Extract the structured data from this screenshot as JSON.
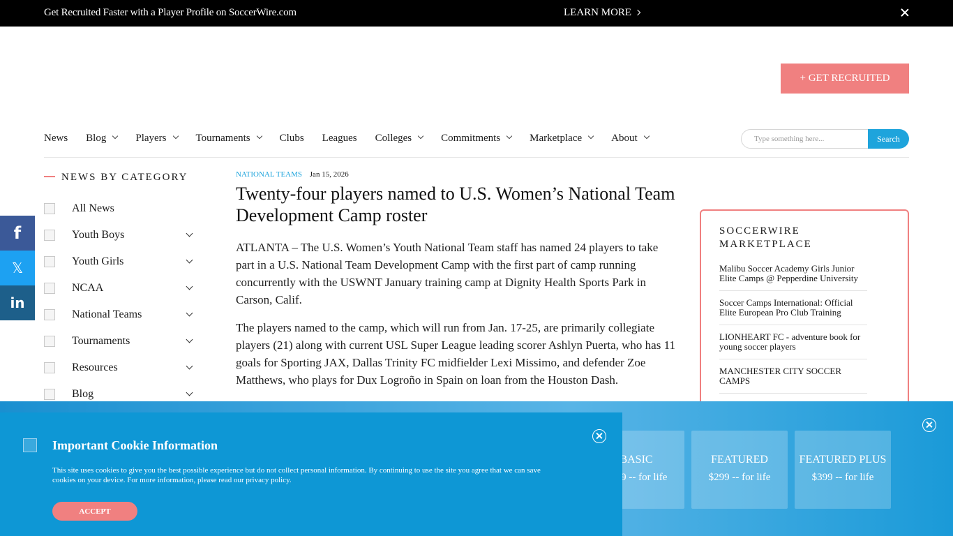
{
  "promo": {
    "text": "Get Recruited Faster with a Player Profile on SoccerWire.com",
    "link": "LEARN MORE"
  },
  "header": {
    "recruit_button": "+ GET RECRUITED"
  },
  "nav": {
    "items": [
      {
        "label": "News",
        "dropdown": false
      },
      {
        "label": "Blog",
        "dropdown": true
      },
      {
        "label": "Players",
        "dropdown": true
      },
      {
        "label": "Tournaments",
        "dropdown": true
      },
      {
        "label": "Clubs",
        "dropdown": false
      },
      {
        "label": "Leagues",
        "dropdown": false
      },
      {
        "label": "Colleges",
        "dropdown": true
      },
      {
        "label": "Commitments",
        "dropdown": true
      },
      {
        "label": "Marketplace",
        "dropdown": true
      },
      {
        "label": "About",
        "dropdown": true
      }
    ],
    "search_placeholder": "Type something here...",
    "search_button": "Search"
  },
  "sidebar": {
    "heading": "NEWS BY CATEGORY",
    "items": [
      {
        "label": "All News",
        "expandable": false
      },
      {
        "label": "Youth Boys",
        "expandable": true
      },
      {
        "label": "Youth Girls",
        "expandable": true
      },
      {
        "label": "NCAA",
        "expandable": true
      },
      {
        "label": "National Teams",
        "expandable": true
      },
      {
        "label": "Tournaments",
        "expandable": true
      },
      {
        "label": "Resources",
        "expandable": true
      },
      {
        "label": "Blog",
        "expandable": true
      }
    ]
  },
  "social": {
    "facebook": "f",
    "x": "𝕏",
    "linkedin": "in"
  },
  "article": {
    "category": "NATIONAL TEAMS",
    "date": "Jan 15, 2026",
    "headline": "Twenty-four players named to U.S. Women’s National Team Development Camp roster",
    "paragraphs": [
      "ATLANTA – The U.S. Women’s Youth National Team staff has named 24 players to take part in a U.S. National Team Development Camp with the first part of camp running concurrently with the USWNT January training camp at Dignity Health Sports Park in Carson, Calif.",
      "The players named to the camp, which will run from Jan. 17-25, are primarily collegiate players (21) along with current USL Super League leading scorer Ashlyn Puerta, who has 11 goals for Sporting JAX, Dallas Trinity FC midfielder Lexi Missimo, and defender Zoe Matthews, who plays for Dux Logroño in Spain on loan from the Houston Dash."
    ]
  },
  "marketplace": {
    "title": "SOCCERWIRE MARKETPLACE",
    "items": [
      "Malibu Soccer Academy Girls Junior Elite Camps @ Pepperdine University",
      "Soccer Camps International: Official Elite European Pro Club Training",
      "LIONHEART FC - adventure book for young soccer players",
      "MANCHESTER CITY SOCCER CAMPS"
    ]
  },
  "pricing": {
    "plans": [
      {
        "name": "BASIC",
        "price": "$199 -- for life"
      },
      {
        "name": "FEATURED",
        "price": "$299 -- for life"
      },
      {
        "name": "FEATURED PLUS",
        "price": "$399 -- for life"
      }
    ]
  },
  "cookie": {
    "title": "Important Cookie Information",
    "text": "This site uses cookies to give you the best possible experience but do not collect personal information. By continuing to use the site you agree that we can save cookies on your device. For more information, please read our privacy policy.",
    "accept": "ACCEPT"
  },
  "colors": {
    "accent_blue": "#1ea4dc",
    "accent_coral": "#f08080",
    "cookie_bg": "#0e97d5"
  }
}
